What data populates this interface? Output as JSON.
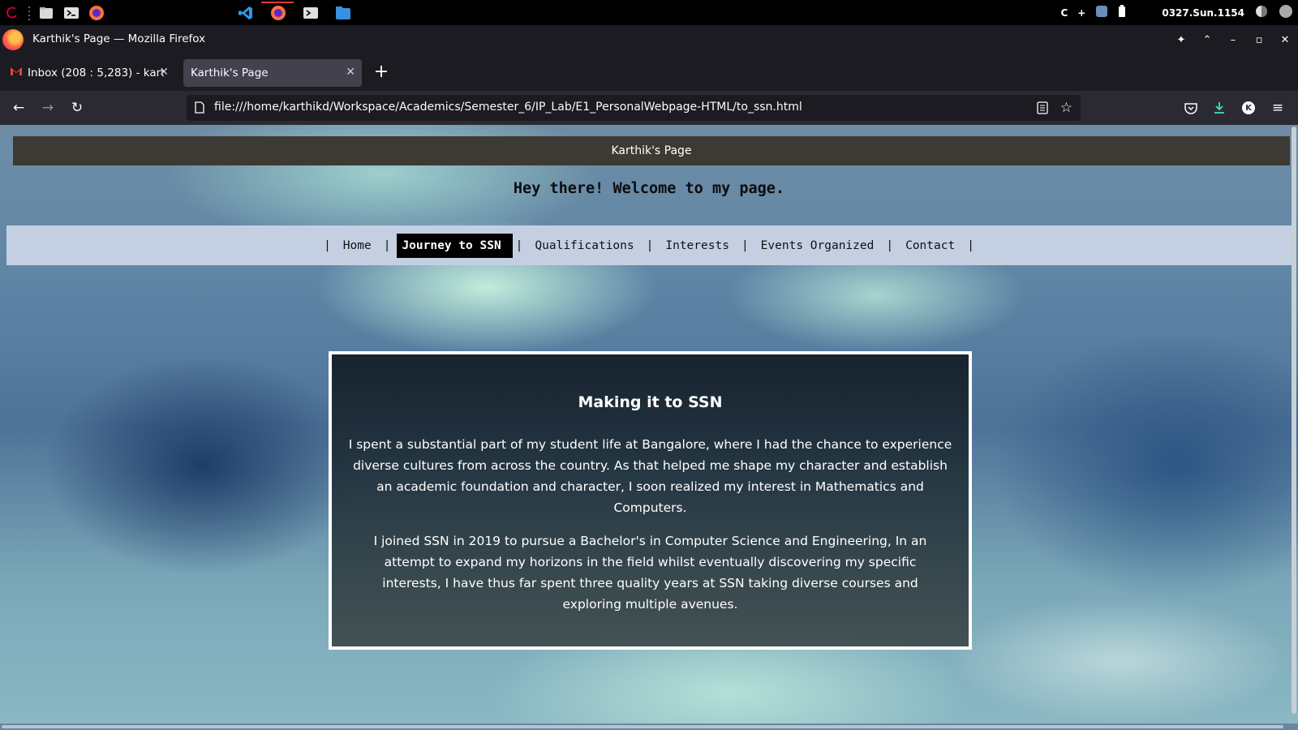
{
  "system_bar": {
    "clock": "0327.Sun.1154",
    "tray_letter": "C",
    "tray_plus": "+"
  },
  "window": {
    "title": "Karthik's Page — Mozilla Firefox"
  },
  "tabs": [
    {
      "label": "Inbox (208 : 5,283) - kart",
      "icon": "gmail-icon",
      "active": false
    },
    {
      "label": "Karthik's Page",
      "active": true
    }
  ],
  "url_bar": {
    "url": "file:///home/karthikd/Workspace/Academics/Semester_6/IP_Lab/E1_PersonalWebpage-HTML/to_ssn.html"
  },
  "account_initial": "K",
  "page": {
    "header": "Karthik's Page",
    "welcome": "Hey there! Welcome to my page.",
    "nav": {
      "separator": "|",
      "items": [
        {
          "label": "Home",
          "current": false
        },
        {
          "label": "Journey to SSN",
          "current": true
        },
        {
          "label": "Qualifications",
          "current": false
        },
        {
          "label": "Interests",
          "current": false
        },
        {
          "label": "Events Organized",
          "current": false
        },
        {
          "label": "Contact",
          "current": false
        }
      ]
    },
    "card": {
      "title": "Making it to SSN",
      "paragraphs": [
        "I spent a substantial part of my student life at Bangalore, where I had the chance to experience diverse cultures from across the country. As that helped me shape my character and establish an academic foundation and character, I soon realized my interest in Mathematics and Computers.",
        "I joined SSN in 2019 to pursue a Bachelor's in Computer Science and Engineering, In an attempt to expand my horizons in the field whilst eventually discovering my specific interests, I have thus far spent three quality years at SSN taking diverse courses and exploring multiple avenues."
      ]
    }
  },
  "colors": {
    "site_header_bg": "#3d3a33",
    "nav_bg": "#c4d0e2",
    "nav_current_bg": "#000000",
    "browser_chrome": "#1c1b22",
    "toolbar": "#2b2a33",
    "active_tab": "#42414d"
  }
}
